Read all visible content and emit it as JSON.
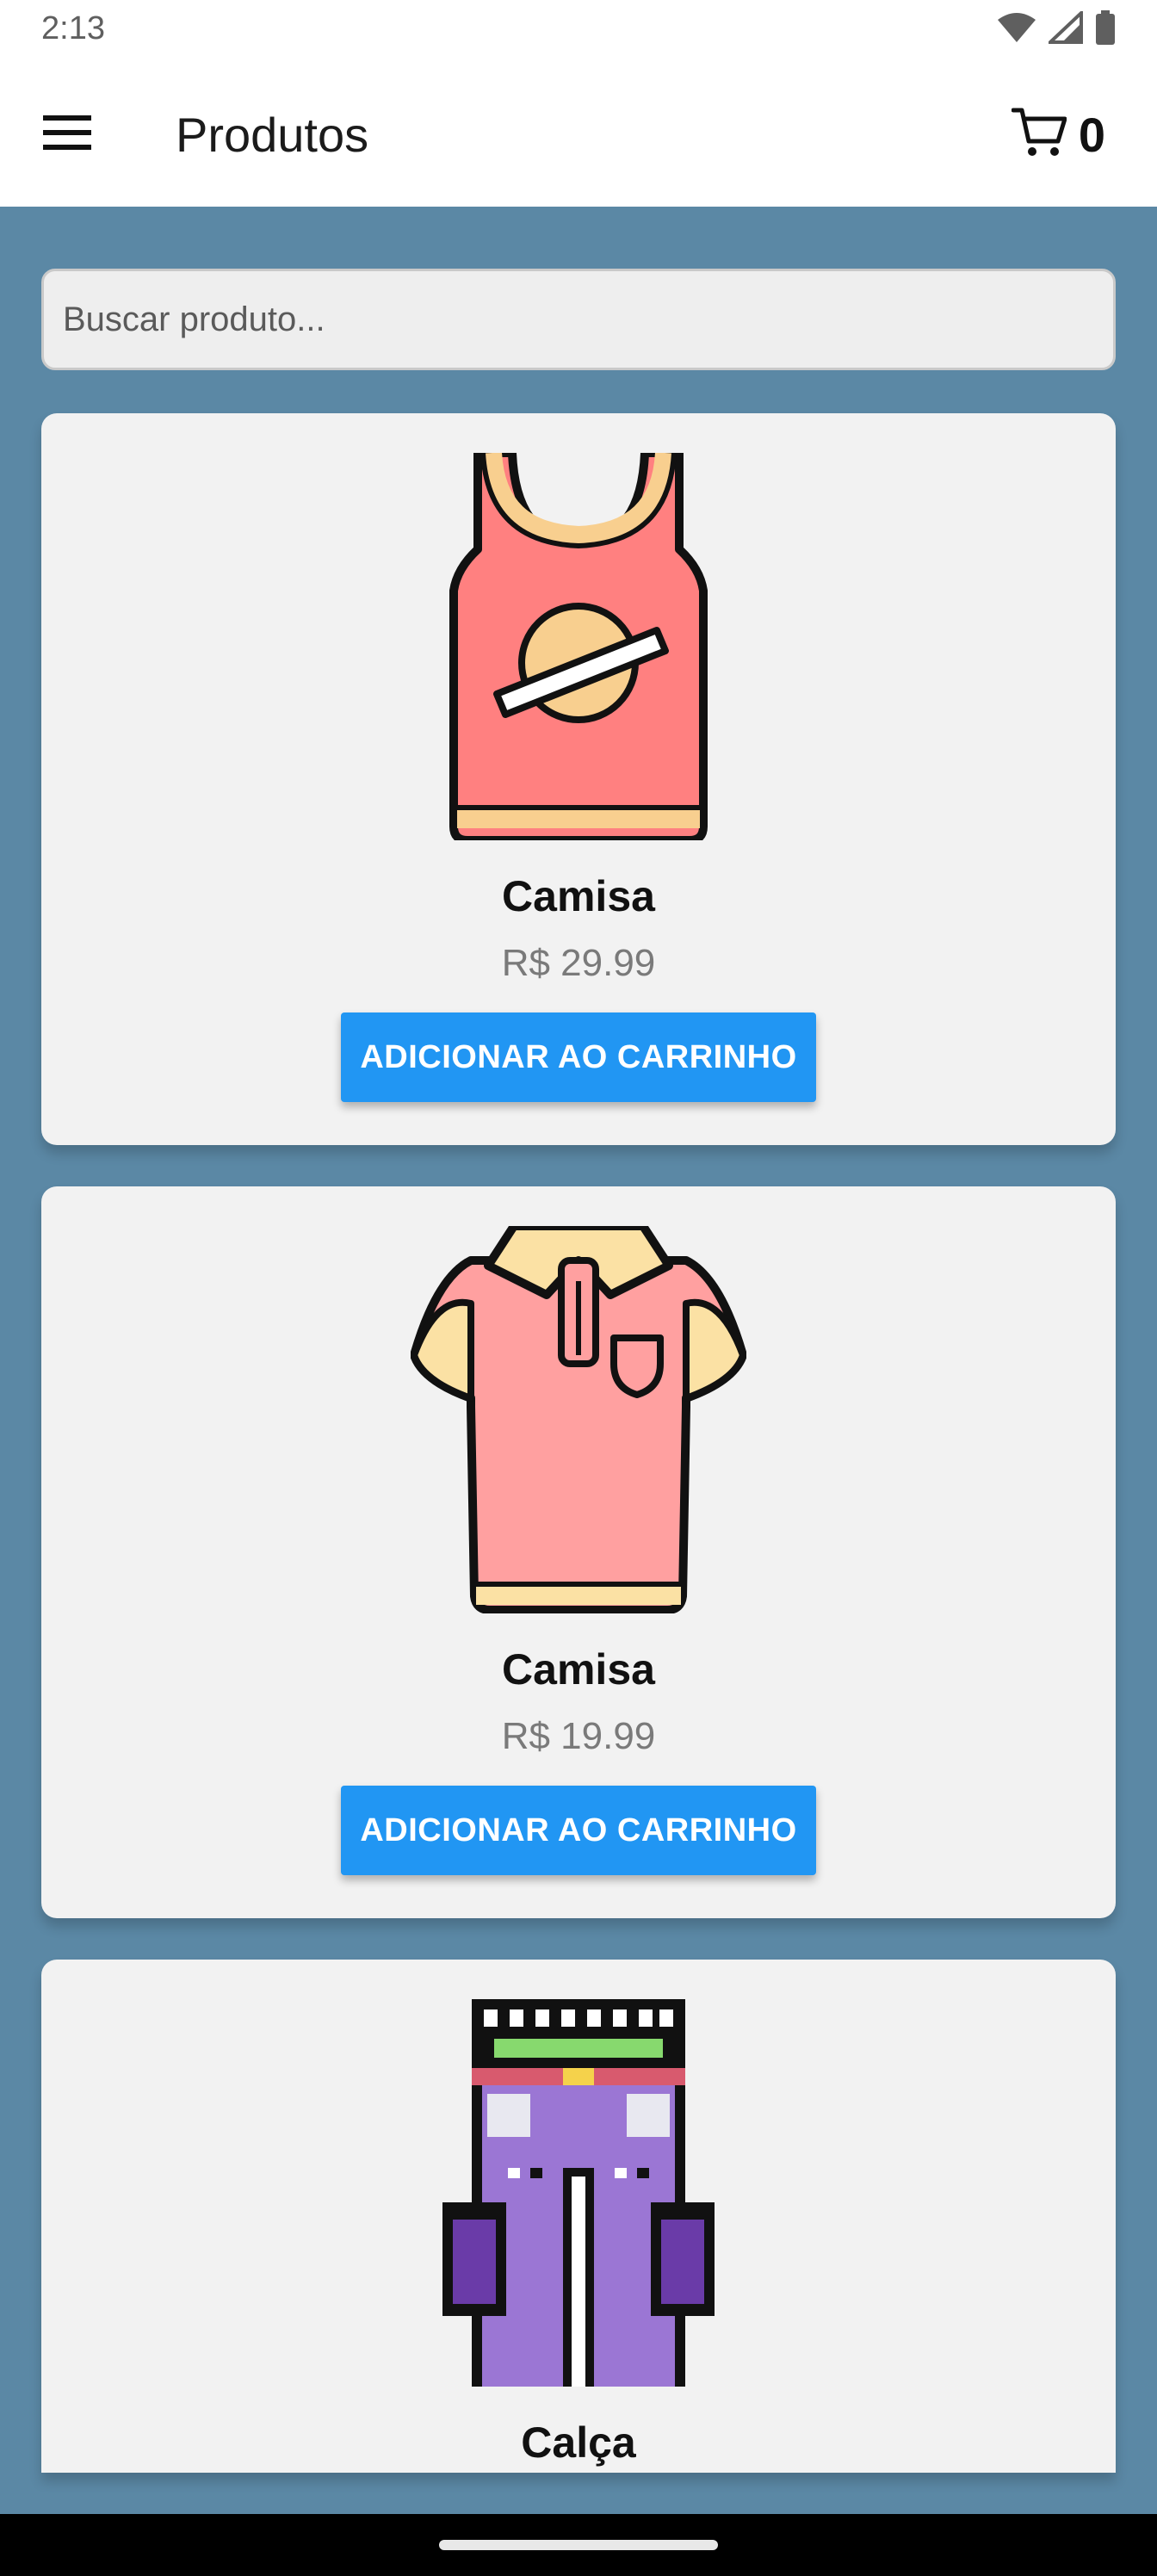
{
  "status_bar": {
    "time": "2:13",
    "icons": [
      "wifi-icon",
      "signal-icon",
      "battery-icon"
    ]
  },
  "app_bar": {
    "title": "Produtos",
    "menu_icon": "hamburger-menu-icon",
    "cart_icon": "shopping-cart-icon",
    "cart_count": "0"
  },
  "search": {
    "placeholder": "Buscar produto...",
    "value": ""
  },
  "products": [
    {
      "name": "Camisa",
      "price": "R$ 29.99",
      "button_label": "ADICIONAR AO CARRINHO",
      "icon": "tank-top-icon"
    },
    {
      "name": "Camisa",
      "price": "R$ 19.99",
      "button_label": "ADICIONAR AO CARRINHO",
      "icon": "polo-shirt-icon"
    },
    {
      "name": "Calça",
      "price": "",
      "button_label": "",
      "icon": "pants-icon"
    }
  ],
  "colors": {
    "background": "#5b88a5",
    "card": "#f2f2f2",
    "button": "#2196f3",
    "price": "#7a7a7a"
  }
}
